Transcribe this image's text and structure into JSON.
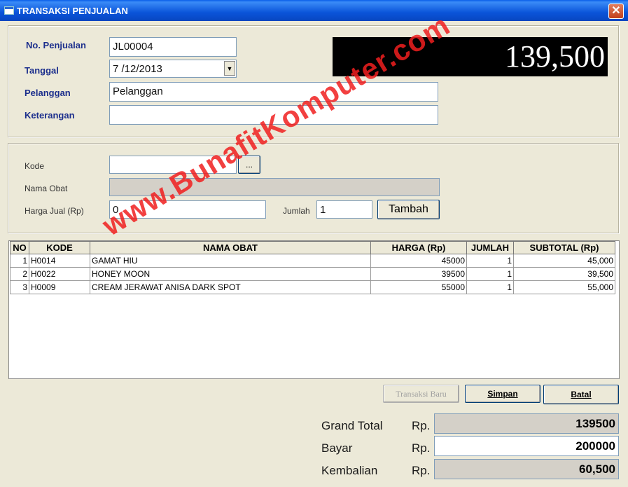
{
  "window": {
    "title": "TRANSAKSI PENJUALAN",
    "close_glyph": "✕"
  },
  "header": {
    "no_penjualan_label": "No. Penjualan",
    "no_penjualan_value": "JL00004",
    "tanggal_label": "Tanggal",
    "tanggal_value": "7 /12/2013",
    "pelanggan_label": "Pelanggan",
    "pelanggan_value": "Pelanggan",
    "keterangan_label": "Keterangan",
    "keterangan_value": "",
    "total_display": "139,500"
  },
  "item_entry": {
    "kode_label": "Kode",
    "kode_value": "",
    "browse_label": "...",
    "nama_obat_label": "Nama Obat",
    "nama_obat_value": "",
    "harga_label": "Harga Jual (Rp)",
    "harga_value": "0",
    "jumlah_label": "Jumlah",
    "jumlah_value": "1",
    "tambah_label": "Tambah"
  },
  "grid": {
    "columns": [
      "NO",
      "KODE",
      "NAMA OBAT",
      "HARGA (Rp)",
      "JUMLAH",
      "SUBTOTAL (Rp)"
    ],
    "rows": [
      [
        "1",
        "H0014",
        "GAMAT HIU",
        "45000",
        "1",
        "45,000"
      ],
      [
        "2",
        "H0022",
        "HONEY MOON",
        "39500",
        "1",
        "39,500"
      ],
      [
        "3",
        "H0009",
        "CREAM JERAWAT ANISA DARK SPOT",
        "55000",
        "1",
        "55,000"
      ]
    ]
  },
  "actions": {
    "transaksi_baru": "Transaksi Baru",
    "simpan": "Simpan",
    "batal": "Batal"
  },
  "summary": {
    "grand_total_label": "Grand Total",
    "grand_total_currency": "Rp.",
    "grand_total_value": "139500",
    "bayar_label": "Bayar",
    "bayar_currency": "Rp.",
    "bayar_value": "200000",
    "kembalian_label": "Kembalian",
    "kembalian_currency": "Rp.",
    "kembalian_value": "60,500"
  },
  "watermark": "www.BunafitKomputer.com",
  "colors": {
    "label_blue": "#1b2e8c",
    "watermark_red": "#f01e1e",
    "titlebar_blue": "#0a54d9"
  }
}
